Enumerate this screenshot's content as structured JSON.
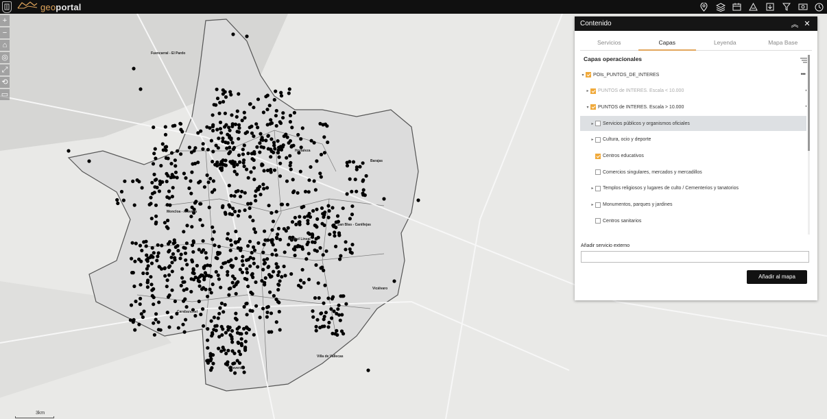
{
  "brand": {
    "name_prefix": "geo",
    "name_suffix": "portal"
  },
  "toolbar_icons": [
    "location-icon",
    "layers-icon",
    "calendar-icon",
    "measure-icon",
    "download-icon",
    "filter-icon",
    "print-icon",
    "history-icon"
  ],
  "map_tools": [
    "+",
    "−",
    "⌂",
    "◎",
    "⤢",
    "⟲",
    "▭"
  ],
  "map": {
    "scale_label": "3km",
    "places": [
      {
        "text": "Fuencarral - El Pardo"
      },
      {
        "text": "Moncloa - Aravaca"
      },
      {
        "text": "San Blas - Canillejas"
      },
      {
        "text": "Vicálvaro"
      },
      {
        "text": "Villa de Vallecas"
      },
      {
        "text": "Villaverde"
      },
      {
        "text": "Carabanchel"
      },
      {
        "text": "Hortaleza"
      },
      {
        "text": "Barajas"
      },
      {
        "text": "Ciudad Lineal"
      }
    ]
  },
  "panel": {
    "title": "Contenido",
    "tabs": [
      {
        "label": "Servicios",
        "active": false
      },
      {
        "label": "Capas",
        "active": true
      },
      {
        "label": "Leyenda",
        "active": false
      },
      {
        "label": "Mapa Base",
        "active": false
      }
    ],
    "section_title": "Capas operacionales",
    "layers": [
      {
        "label": "POIs_PUNTOS_DE_INTERES",
        "checked": true,
        "arrow": "▾",
        "level": 0,
        "dim": false,
        "highlight": false
      },
      {
        "label": "PUNTOS de INTERES. Escala < 10.000",
        "checked": true,
        "arrow": "▸",
        "level": 1,
        "dim": true,
        "highlight": false
      },
      {
        "label": "PUNTOS de INTERES. Escala > 10.000",
        "checked": true,
        "arrow": "▾",
        "level": 1,
        "dim": false,
        "highlight": false
      },
      {
        "label": "Servicios públicos y organismos oficiales",
        "checked": false,
        "arrow": "▸",
        "level": 2,
        "dim": false,
        "highlight": true
      },
      {
        "label": "Cultura, ocio y deporte",
        "checked": false,
        "arrow": "▸",
        "level": 2,
        "dim": false,
        "highlight": false
      },
      {
        "label": "Centros educativos",
        "checked": true,
        "arrow": "",
        "level": 2,
        "dim": false,
        "highlight": false
      },
      {
        "label": "Comercios singulares, mercados y mercadillos",
        "checked": false,
        "arrow": "",
        "level": 2,
        "dim": false,
        "highlight": false
      },
      {
        "label": "Templos religiosos y lugares de culto / Cementerios y tanatorios",
        "checked": false,
        "arrow": "▸",
        "level": 2,
        "dim": false,
        "highlight": false
      },
      {
        "label": "Monumentos, parques y jardines",
        "checked": false,
        "arrow": "▸",
        "level": 2,
        "dim": false,
        "highlight": false
      },
      {
        "label": "Centros sanitarios",
        "checked": false,
        "arrow": "",
        "level": 2,
        "dim": false,
        "highlight": false
      }
    ],
    "external_service_label": "Añadir servicio externo",
    "external_service_value": "",
    "add_button_label": "Añadir al mapa"
  }
}
